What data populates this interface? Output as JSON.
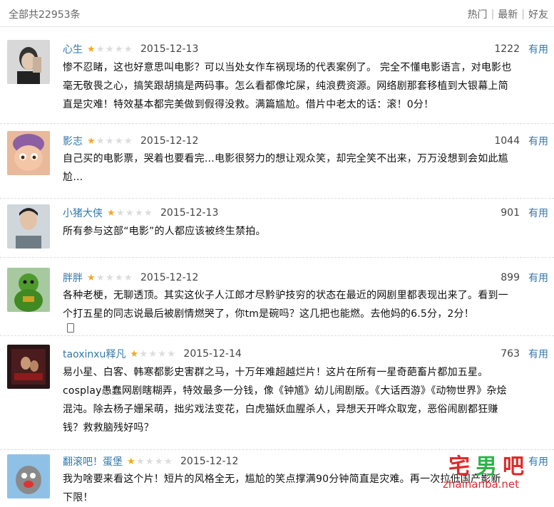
{
  "header": {
    "total_text": "全部共22953条",
    "sort_hot": "热门",
    "sort_latest": "最新",
    "sort_friends": "好友"
  },
  "reviews": [
    {
      "user": "心生",
      "rating": 1,
      "date": "2015-12-13",
      "votes": "1222",
      "useful_label": "有用",
      "lines": [
        "惨不忍睹，这也好意思叫电影？可以当处女作车祸现场的代表案例了。 完全不懂电影语言，对电影也",
        "毫无敬畏之心，搞笑跟胡搞是两码事。怎么看都像坨屎，纯浪费资源。网络剧那套移植到大银幕上简",
        "直是灾难！特效基本都完美做到假得没救。满篇尴尬。借片中老太的话：滚！0分！"
      ]
    },
    {
      "user": "影志",
      "rating": 1,
      "date": "2015-12-12",
      "votes": "1044",
      "useful_label": "有用",
      "lines": [
        "自己买的电影票，哭着也要看完…电影很努力的想让观众笑，却完全笑不出来，万万没想到会如此尴",
        "尬…"
      ]
    },
    {
      "user": "小猪大侠",
      "rating": 1,
      "date": "2015-12-13",
      "votes": "901",
      "useful_label": "有用",
      "lines": [
        "所有参与这部“电影”的人都应该被终生禁拍。"
      ]
    },
    {
      "user": "胖胖",
      "rating": 1,
      "date": "2015-12-12",
      "votes": "899",
      "useful_label": "有用",
      "lines": [
        "各种老梗，无聊透顶。其实这伙子人江郎才尽黔驴技穷的状态在最近的网剧里都表现出来了。看到一",
        "个打五星的同志说最后被剧情燃哭了，你tm是碗吗？这几把也能燃。去他妈的6.5分，2分！"
      ]
    },
    {
      "user": "taoxinxu释凡",
      "rating": 1,
      "date": "2015-12-14",
      "votes": "763",
      "useful_label": "有用",
      "lines": [
        "易小星、白客、韩寒都影史害群之马，十万年难超越烂片！这片在所有一星奇葩畜片都加五星。",
        "cosplay愚蠢网剧瞎糊弄，特效最多一分钱，像《钟馗》幼儿闹剧版。《大话西游》《动物世界》杂烩",
        "混沌。除去杨子姗呆萌，拙劣戏法变花，白虎猫妖血腥杀人，异想天开哗众取宠，恶俗闹剧都狂赚",
        "钱？救救脑残好吗？"
      ]
    },
    {
      "user": "翻滚吧！蛋堡",
      "rating": 1,
      "date": "2015-12-12",
      "votes": "",
      "useful_label": "有用",
      "lines": [
        "我为啥要来看这个片！短片的风格全无，尴尬的笑点撑满90分钟简直是灾难。再一次拉低国产影新",
        "下限！"
      ]
    }
  ],
  "watermark": {
    "brand": "宅男吧",
    "domain": "zhainanba.net"
  },
  "colors": {
    "link": "#3377aa",
    "star_on": "#f5a623",
    "star_off": "#dcdcdc",
    "watermark_red": "#e02a2a",
    "watermark_green": "#2db34a"
  }
}
